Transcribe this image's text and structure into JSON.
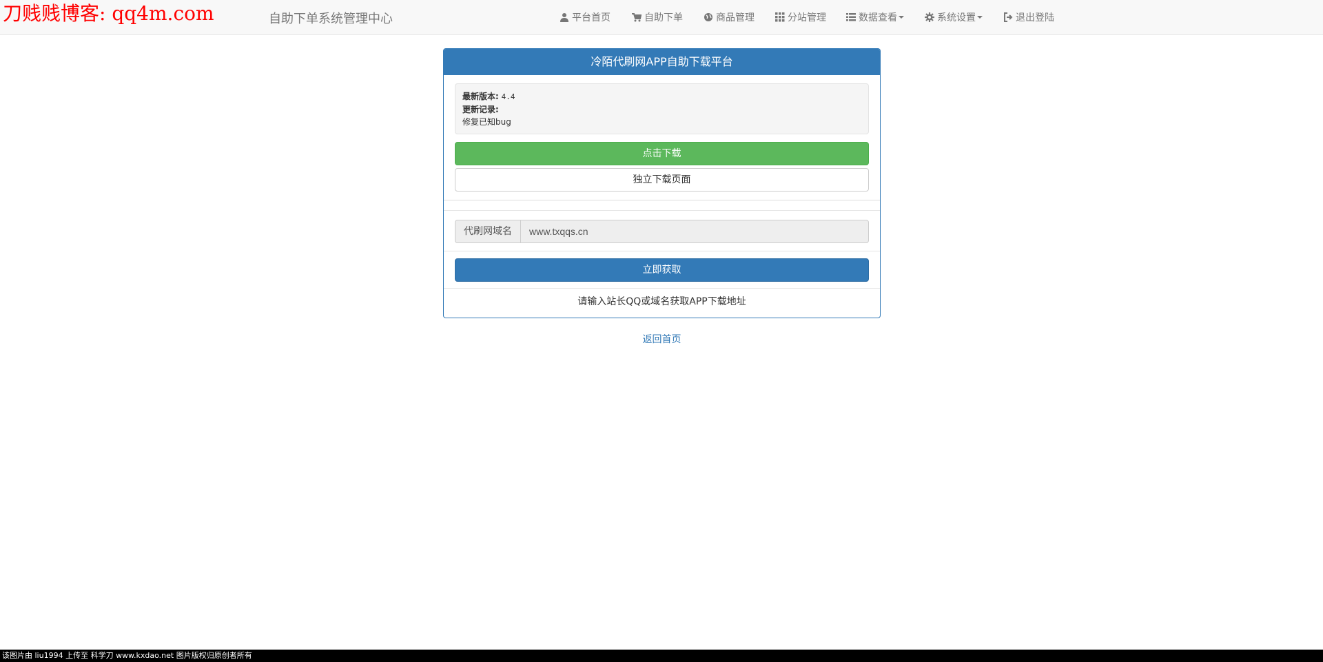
{
  "watermark": {
    "text": "刀贱贱博客: qq4m.com",
    "color": "#ff0000"
  },
  "navbar": {
    "brand": "自助下单系统管理中心",
    "items": [
      {
        "label": "平台首页",
        "icon": "user-icon"
      },
      {
        "label": "自助下单",
        "icon": "cart-icon"
      },
      {
        "label": "商品管理",
        "icon": "globe-icon"
      },
      {
        "label": "分站管理",
        "icon": "grid-icon"
      },
      {
        "label": "数据查看",
        "icon": "list-icon",
        "dropdown": true
      },
      {
        "label": "系统设置",
        "icon": "gear-icon",
        "dropdown": true
      },
      {
        "label": "退出登陆",
        "icon": "logout-icon"
      }
    ]
  },
  "panel": {
    "title": "冷陌代刷网APP自助下载平台",
    "latest_version_label": "最新版本:",
    "latest_version_value": "4.4",
    "changelog_label": "更新记录:",
    "changelog_text": "修复已知bug",
    "download_button": "点击下载",
    "standalone_button": "独立下载页面",
    "domain_addon": "代刷网域名",
    "domain_value": "www.txqqs.cn",
    "get_button": "立即获取",
    "hint_text": "请输入站长QQ或域名获取APP下载地址"
  },
  "back_link": "返回首页",
  "bottom_strip": "该图片由 liu1994 上传至 科学刀 www.kxdao.net 图片版权归原创者所有",
  "colors": {
    "primary": "#337ab7",
    "success": "#5cb85c",
    "navbar_bg": "#f8f8f8"
  }
}
